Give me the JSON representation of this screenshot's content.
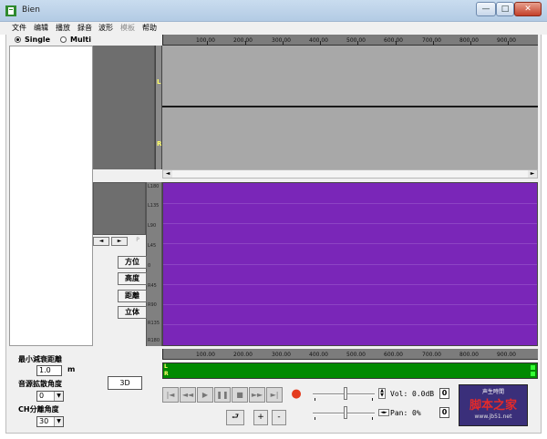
{
  "window": {
    "title": "Bien",
    "controls": {
      "minimize": "—",
      "maximize": "□",
      "close": "✕"
    }
  },
  "menu": {
    "items": [
      {
        "label": "文件",
        "enabled": true
      },
      {
        "label": "编辑",
        "enabled": true
      },
      {
        "label": "播放",
        "enabled": true
      },
      {
        "label": "録音",
        "enabled": true
      },
      {
        "label": "波形",
        "enabled": true
      },
      {
        "label": "模板",
        "enabled": false
      },
      {
        "label": "帮助",
        "enabled": true
      }
    ]
  },
  "mode": {
    "single_label": "Single",
    "multi_label": "Multi",
    "selected": "Single"
  },
  "channels": {
    "left": "L",
    "right": "R"
  },
  "ruler": {
    "labels": [
      "100.00",
      "200.00",
      "300.00",
      "400.00",
      "500.00",
      "600.00",
      "700.00",
      "800.00",
      "900.00"
    ]
  },
  "position_scale": {
    "labels": [
      "L180",
      "L135",
      "L90",
      "L45",
      "0",
      "R45",
      "R90",
      "R135",
      "R180"
    ]
  },
  "mini_nav": {
    "left": "◄",
    "right": "►",
    "page": "P"
  },
  "side_buttons": [
    {
      "label": "方位"
    },
    {
      "label": "高度"
    },
    {
      "label": "距離"
    },
    {
      "label": "立体"
    }
  ],
  "params": {
    "min_decay_label": "最小減衰距離",
    "min_decay_value": "1.0",
    "min_decay_unit": "m",
    "spread_label": "音源拡散角度",
    "spread_value": "0",
    "ch_sep_label": "CH分離角度",
    "ch_sep_value": "30",
    "mode_3d": "3D"
  },
  "transport": {
    "buttons": [
      "|◄",
      "◄◄",
      "▶",
      "❚❚",
      "■",
      "►►",
      "►|",
      "●"
    ]
  },
  "edit_buttons": {
    "loop": "⮐",
    "plus": "+",
    "minus": "-"
  },
  "vol": {
    "label": "Vol:",
    "value": "0.0dB",
    "zero": "0"
  },
  "pan": {
    "label": "Pan:",
    "value": "0%",
    "zero": "0"
  },
  "logo": {
    "line1": "声生時間",
    "line2": "脚本之家",
    "line3": "www.jb51.net"
  }
}
